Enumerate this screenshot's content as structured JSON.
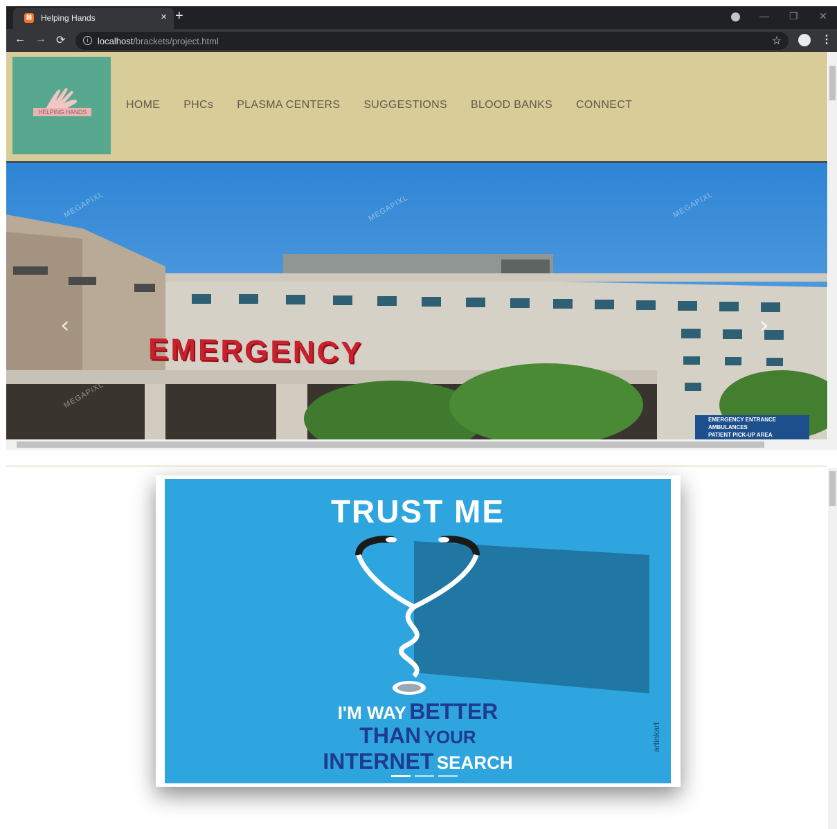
{
  "browser": {
    "tab_title": "Helping Hands",
    "tab_close": "×",
    "new_tab": "+",
    "url_host": "localhost",
    "url_path": "/brackets/project.html",
    "icons": [
      "back-arrow-icon",
      "forward-arrow-icon",
      "reload-icon",
      "info-icon",
      "star-icon",
      "account-icon",
      "menu-icon",
      "tab-favicon-icon"
    ]
  },
  "header": {
    "logo_text": "HELPING HANDS",
    "nav": [
      "HOME",
      "PHCs",
      "PLASMA CENTERS",
      "SUGGESTIONS",
      "BLOOD BANKS",
      "CONNECT"
    ],
    "bg_color": "#d8cc99",
    "logo_color": "#58a890"
  },
  "hero": {
    "sign_text": "EMERGENCY",
    "watermark": "MEGAPIXL",
    "entrance_sign": [
      "EMERGENCY ENTRANCE",
      "AMBULANCES",
      "PATIENT PICK-UP AREA"
    ],
    "prev_label": "‹",
    "next_label": "›"
  },
  "poster": {
    "title": "TRUST ME",
    "line1_a": "I'M WAY",
    "line1_b": "BETTER",
    "line2_a": "THAN",
    "line2_b": "YOUR",
    "line3_a": "INTERNET",
    "line3_b": "SEARCH",
    "signature": "artinkart",
    "bg_color": "#2ea5df",
    "indicator_count": 3,
    "active_indicator": 1
  }
}
